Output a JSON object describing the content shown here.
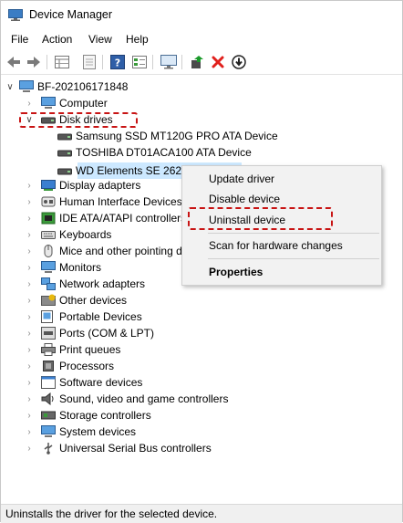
{
  "window": {
    "title": "Device Manager"
  },
  "menu": [
    "File",
    "Action",
    "View",
    "Help"
  ],
  "toolbar": {
    "icons": [
      "back-icon",
      "forward-icon",
      "properties-grid-icon",
      "properties-sheet-icon",
      "help-icon",
      "details-view-icon",
      "monitor-icon",
      "update-driver-icon",
      "uninstall-icon",
      "scan-hardware-icon"
    ]
  },
  "tree": {
    "root": "BF-202106171848",
    "computer": "Computer",
    "disk_drives": "Disk drives",
    "disks": [
      "Samsung SSD MT120G PRO ATA Device",
      "TOSHIBA DT01ACA100 ATA Device",
      "WD Elements SE 2623 USB Device"
    ],
    "categories": [
      "Display adapters",
      "Human Interface Devices",
      "IDE ATA/ATAPI controllers",
      "Keyboards",
      "Mice and other pointing devices",
      "Monitors",
      "Network adapters",
      "Other devices",
      "Portable Devices",
      "Ports (COM & LPT)",
      "Print queues",
      "Processors",
      "Software devices",
      "Sound, video and game controllers",
      "Storage controllers",
      "System devices",
      "Universal Serial Bus controllers"
    ]
  },
  "context_menu": {
    "update_driver": "Update driver",
    "disable_device": "Disable device",
    "uninstall_device": "Uninstall device",
    "scan": "Scan for hardware changes",
    "properties": "Properties"
  },
  "status": "Uninstalls the driver for the selected device.",
  "colors": {
    "highlight": "#c81414",
    "selection": "#cce8ff",
    "uninstall_red": "#e0201c"
  }
}
